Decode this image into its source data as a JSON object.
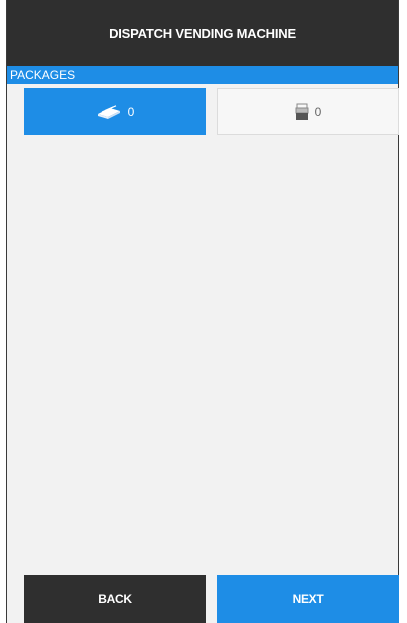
{
  "header": {
    "title": "DISPATCH VENDING MACHINE"
  },
  "section": {
    "label": "PACKAGES"
  },
  "tabs": [
    {
      "icon": "package-stack-icon",
      "count": "0",
      "active": true
    },
    {
      "icon": "bag-icon",
      "count": "0",
      "active": false
    }
  ],
  "footer": {
    "back_label": "BACK",
    "next_label": "NEXT"
  },
  "colors": {
    "accent": "#1e8de6",
    "dark": "#2f2f2f",
    "background": "#f2f2f2"
  }
}
